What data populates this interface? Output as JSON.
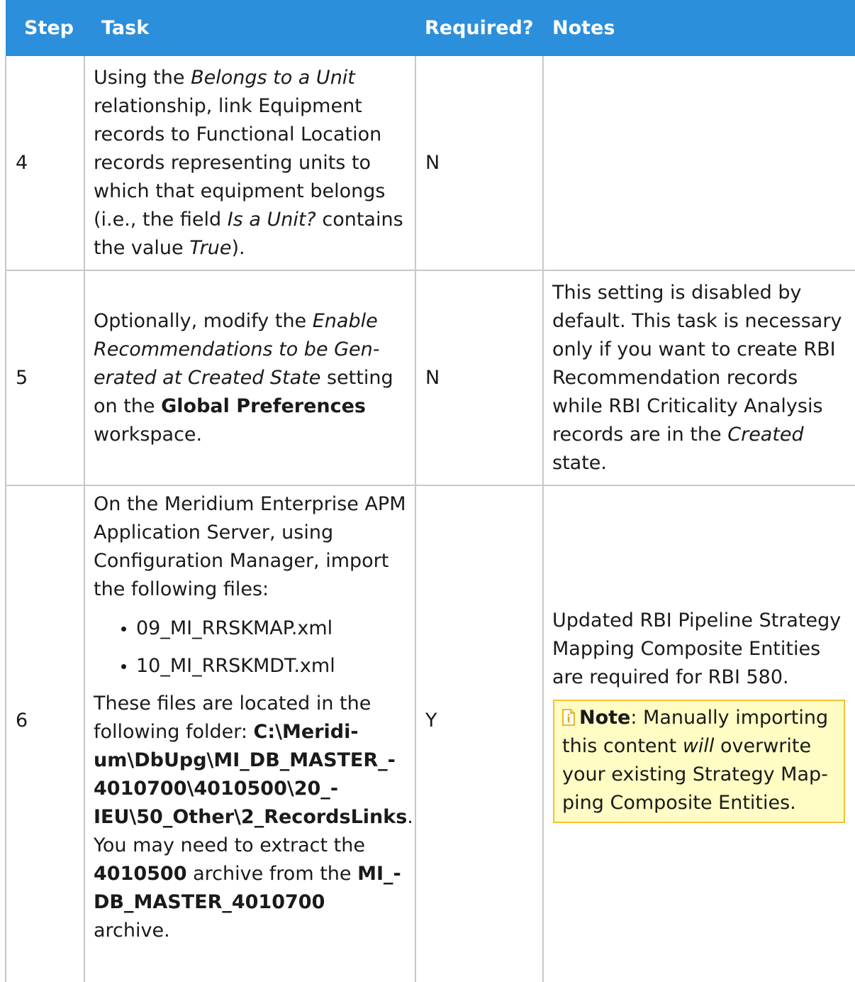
{
  "table": {
    "headers": {
      "step": "Step",
      "task": "Task",
      "required": "Required?",
      "notes": "Notes"
    },
    "rows": [
      {
        "step": "4",
        "task": {
          "t1": "Using the ",
          "t2": "Belongs to a Unit",
          "t3": " relationship, link Equipment records to Functional Location records representing units to which that equipment belongs (i.e., the field ",
          "t4": "Is a Unit?",
          "t5": " con­tains the value ",
          "t6": "True",
          "t7": ")."
        },
        "required": "N",
        "notes": ""
      },
      {
        "step": "5",
        "task": {
          "t1": "Optionally, modify the ",
          "t2": "Enable Recommendations to be Gen­erated at Created State",
          "t3": " setting on the ",
          "t4": "Global Preferences",
          "t5": " workspace."
        },
        "required": "N",
        "notes": {
          "n1": "This setting is disabled by default. This task is necessary only if you want to create RBI Recommendation records while RBI Criticality Analysis records are in the ",
          "n2": "Created",
          "n3": " state."
        }
      },
      {
        "step": "6",
        "task": {
          "intro": "On the Meridium Enterprise APM Application Server, using Configuration Manager, import the following files:",
          "files": [
            "09_MI_RRSKMAP.xml",
            "10_MI_RRSKMDT.xml"
          ],
          "loc1": "These files are located in the following folder: ",
          "loc_path": "C:\\Meridi­um\\DbUpg\\MI_DB_MASTER_­4010700\\4010500\\20_­IEU\\50_Other\\2_RecordsLinks",
          "loc2": ". You may need to extract the ",
          "loc_archive": "4010500",
          "loc3": " archive from the ",
          "loc_master": "MI_­DB_MASTER_4010700",
          "loc4": " archive."
        },
        "required": "Y",
        "notes": {
          "text": "Updated RBI Pipeline Strategy Mapping Composite Entities are required for RBI 580.",
          "note_label": "Note",
          "note_t1": ": Manually importing this content ",
          "note_t2": "will",
          "note_t3": " overwrite your existing Strategy Map­ping Composite Entities."
        }
      }
    ]
  },
  "colors": {
    "header_bg": "#2b8fdc",
    "note_bg": "#fffcc4",
    "note_border": "#f2c231"
  },
  "icons": {
    "note": "note-info-icon"
  }
}
